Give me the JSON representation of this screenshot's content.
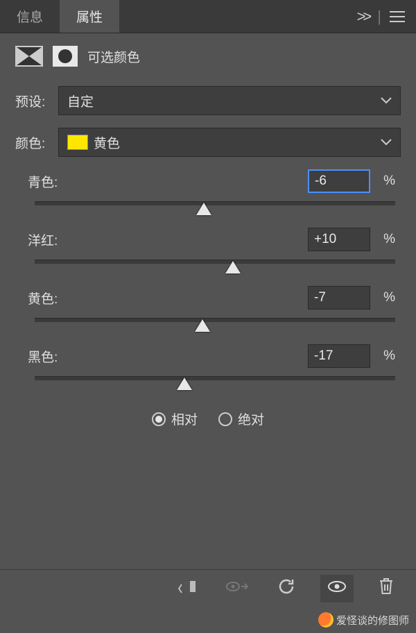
{
  "tabs": {
    "info": "信息",
    "properties": "属性"
  },
  "panel_title": "可选颜色",
  "preset": {
    "label": "预设:",
    "value": "自定"
  },
  "color": {
    "label": "颜色:",
    "value": "黄色",
    "swatch": "#ffe600"
  },
  "sliders": {
    "cyan": {
      "label": "青色:",
      "value": "-6",
      "pct": "%",
      "pos": 47,
      "focused": true
    },
    "magenta": {
      "label": "洋红:",
      "value": "+10",
      "pct": "%",
      "pos": 55,
      "focused": false
    },
    "yellow": {
      "label": "黄色:",
      "value": "-7",
      "pct": "%",
      "pos": 46.5,
      "focused": false
    },
    "black": {
      "label": "黑色:",
      "value": "-17",
      "pct": "%",
      "pos": 41.5,
      "focused": false
    }
  },
  "method": {
    "relative": "相对",
    "absolute": "绝对",
    "selected": "relative"
  },
  "watermark": "爱怪谈的修图师"
}
